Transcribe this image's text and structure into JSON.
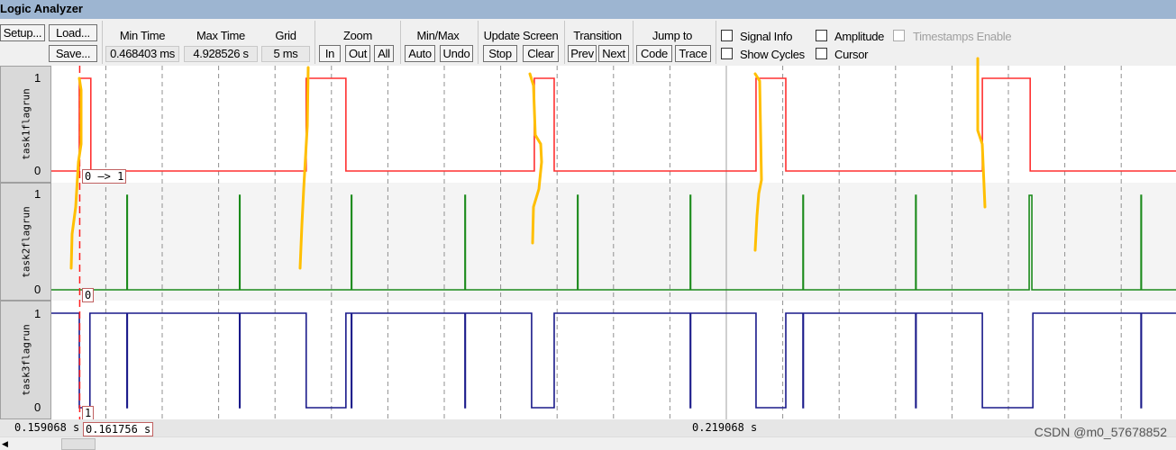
{
  "window": {
    "title": "Logic Analyzer"
  },
  "toolbar": {
    "setup": "Setup...",
    "load": "Load...",
    "save": "Save...",
    "min_time_label": "Min Time",
    "min_time_value": "0.468403 ms",
    "max_time_label": "Max Time",
    "max_time_value": "4.928526 s",
    "grid_label": "Grid",
    "grid_value": "5 ms",
    "zoom_label": "Zoom",
    "zoom_in": "In",
    "zoom_out": "Out",
    "zoom_all": "All",
    "minmax_label": "Min/Max",
    "auto": "Auto",
    "undo": "Undo",
    "update_label": "Update Screen",
    "stop": "Stop",
    "clear": "Clear",
    "transition_label": "Transition",
    "prev": "Prev",
    "next": "Next",
    "jump_label": "Jump to",
    "code": "Code",
    "trace": "Trace",
    "checkboxes": [
      {
        "label": "Signal Info",
        "checked": false,
        "enabled": true
      },
      {
        "label": "Amplitude",
        "checked": false,
        "enabled": true
      },
      {
        "label": "Timestamps Enable",
        "checked": false,
        "enabled": false
      },
      {
        "label": "Show Cycles",
        "checked": false,
        "enabled": true
      },
      {
        "label": "Cursor",
        "checked": false,
        "enabled": true
      }
    ]
  },
  "chart_data": {
    "type": "line",
    "time_unit": "s",
    "grid": "5 ms",
    "xlim": [
      0.159068,
      0.25894
    ],
    "signals": [
      {
        "name": "task1flagrun",
        "color": "#ff3030",
        "high_label": "1",
        "low_label": "0",
        "value_label": "0 —> 1",
        "initial": 0,
        "high_intervals": [
          [
            0.16172,
            0.16274
          ],
          [
            0.18183,
            0.18535
          ],
          [
            0.20205,
            0.20381
          ],
          [
            0.2217,
            0.22434
          ],
          [
            0.24176,
            0.246
          ]
        ]
      },
      {
        "name": "task2flagrun",
        "color": "#1a8a1a",
        "high_label": "1",
        "low_label": "0",
        "value_label": "0",
        "initial": 0,
        "high_intervals": [
          [
            0.16594,
            0.16598
          ],
          [
            0.17592,
            0.17596
          ],
          [
            0.18583,
            0.18587
          ],
          [
            0.1959,
            0.19594
          ],
          [
            0.20588,
            0.20592
          ],
          [
            0.21587,
            0.21591
          ],
          [
            0.22586,
            0.2259
          ],
          [
            0.23585,
            0.23589
          ],
          [
            0.24591,
            0.24615
          ],
          [
            0.25582,
            0.25586
          ]
        ]
      },
      {
        "name": "task3flagrun",
        "color": "#1a1a8a",
        "high_label": "1",
        "low_label": "0",
        "value_label": "1",
        "initial": 1,
        "low_intervals": [
          [
            0.16172,
            0.16266
          ],
          [
            0.16594,
            0.16598
          ],
          [
            0.17592,
            0.17596
          ],
          [
            0.18183,
            0.18535
          ],
          [
            0.18583,
            0.18587
          ],
          [
            0.1959,
            0.19594
          ],
          [
            0.20181,
            0.20381
          ],
          [
            0.21587,
            0.21591
          ],
          [
            0.2217,
            0.22434
          ],
          [
            0.22586,
            0.2259
          ],
          [
            0.23585,
            0.23589
          ],
          [
            0.24176,
            0.24624
          ],
          [
            0.25582,
            0.25586
          ]
        ]
      }
    ],
    "cursor_time": "0.161756 s",
    "axis_left_time": "0.159068 s",
    "axis_center_time": "0.219068 s"
  },
  "watermark": "CSDN @m0_57678852",
  "annotation_color": "#ffbf00"
}
